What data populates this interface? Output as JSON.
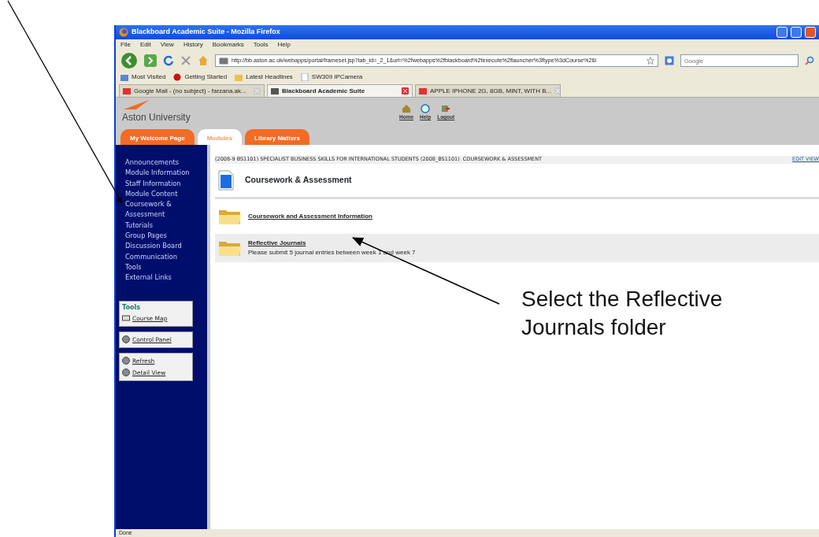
{
  "window": {
    "title": "Blackboard Academic Suite - Mozilla Firefox"
  },
  "menu": [
    "File",
    "Edit",
    "View",
    "History",
    "Bookmarks",
    "Tools",
    "Help"
  ],
  "address": {
    "url": "http://bb.aston.ac.uk/webapps/portal/frameset.jsp?tab_id=_2_1&url=%2fwebapps%2fblackboard%2fexecute%2flauncher%3ftype%3dCourse%26i"
  },
  "search": {
    "placeholder": "Google"
  },
  "bookmarks": [
    "Most Visited",
    "Getting Started",
    "Latest Headlines",
    "SW309 IPCamera"
  ],
  "browser_tabs": [
    {
      "label": "Google Mail - (no subject) - farzana.ak...",
      "selected": false
    },
    {
      "label": "Blackboard Academic Suite",
      "selected": true
    },
    {
      "label": "APPLE IPHONE 2G, 8GB, MINT, WITH B...",
      "selected": false
    }
  ],
  "site": {
    "logo": "Aston University",
    "header_links": [
      "Home",
      "Help",
      "Logout"
    ],
    "tabs": [
      {
        "label": "My Welcome Page",
        "selected": false
      },
      {
        "label": "Modules",
        "selected": true
      },
      {
        "label": "Library Matters",
        "selected": false
      }
    ]
  },
  "sidebar": {
    "items": [
      "Announcements",
      "Module Information",
      "Staff Information",
      "Module Content",
      "Coursework & Assessment",
      "Tutorials",
      "Group Pages",
      "Discussion Board",
      "Communication",
      "Tools",
      "External Links"
    ],
    "panels": [
      {
        "title": "Tools",
        "items": [
          "Course Map"
        ]
      },
      {
        "items": [
          "Control Panel"
        ]
      },
      {
        "items": [
          "Refresh",
          "Detail View"
        ]
      }
    ]
  },
  "breadcrumb": {
    "link": "(2008-9 BS1101) SPECIALIST BUSINESS SKILLS FOR INTERNATIONAL STUDENTS (2008_BS1101)",
    "current": "COURSEWORK & ASSESSMENT",
    "edit_view": "EDIT VIEW"
  },
  "page_title": "Coursework & Assessment",
  "folders": [
    {
      "title": "Coursework and Assessment Information",
      "selected": false
    },
    {
      "title": "Reflective Journals",
      "description": "Please submit 5 journal entries between week 1 and week 7",
      "selected": true
    }
  ],
  "status_bar": "Done",
  "annotation": {
    "text": "Select the Reflective Journals folder"
  }
}
